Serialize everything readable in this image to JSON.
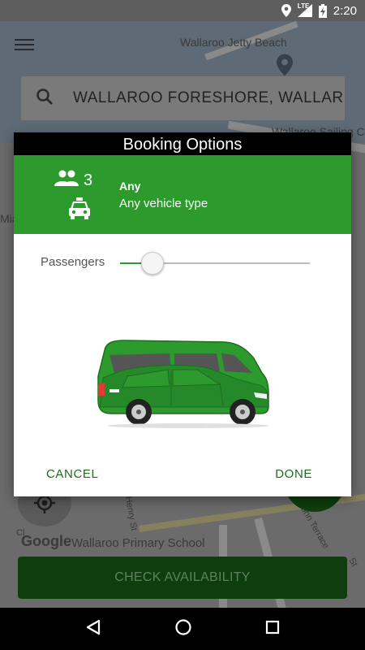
{
  "status_bar": {
    "network": "LTE",
    "time": "2:20"
  },
  "map": {
    "labels": {
      "jetty": "Wallaroo Jetty Beach",
      "sailing": "Wallaroo Sailing C",
      "school": "Wallaroo Primary School",
      "henry": "Henry St",
      "john": "John Terrace",
      "mia": "Mia",
      "cl": "Cl",
      "st": "St"
    },
    "google_logo": "Google"
  },
  "search": {
    "value": "WALLAROO FORESHORE, WALLAR"
  },
  "check_button": {
    "label": "CHECK AVAILABILITY"
  },
  "dialog": {
    "title": "Booking Options",
    "passenger_count": "3",
    "vehicle_title": "Any",
    "vehicle_subtitle": "Any vehicle type",
    "slider_label": "Passengers",
    "slider_fraction": 0.17,
    "cancel_label": "CANCEL",
    "done_label": "DONE"
  },
  "colors": {
    "accent": "#2c9a2c",
    "button_text": "#1f6b1f",
    "title_bg": "#000000"
  }
}
